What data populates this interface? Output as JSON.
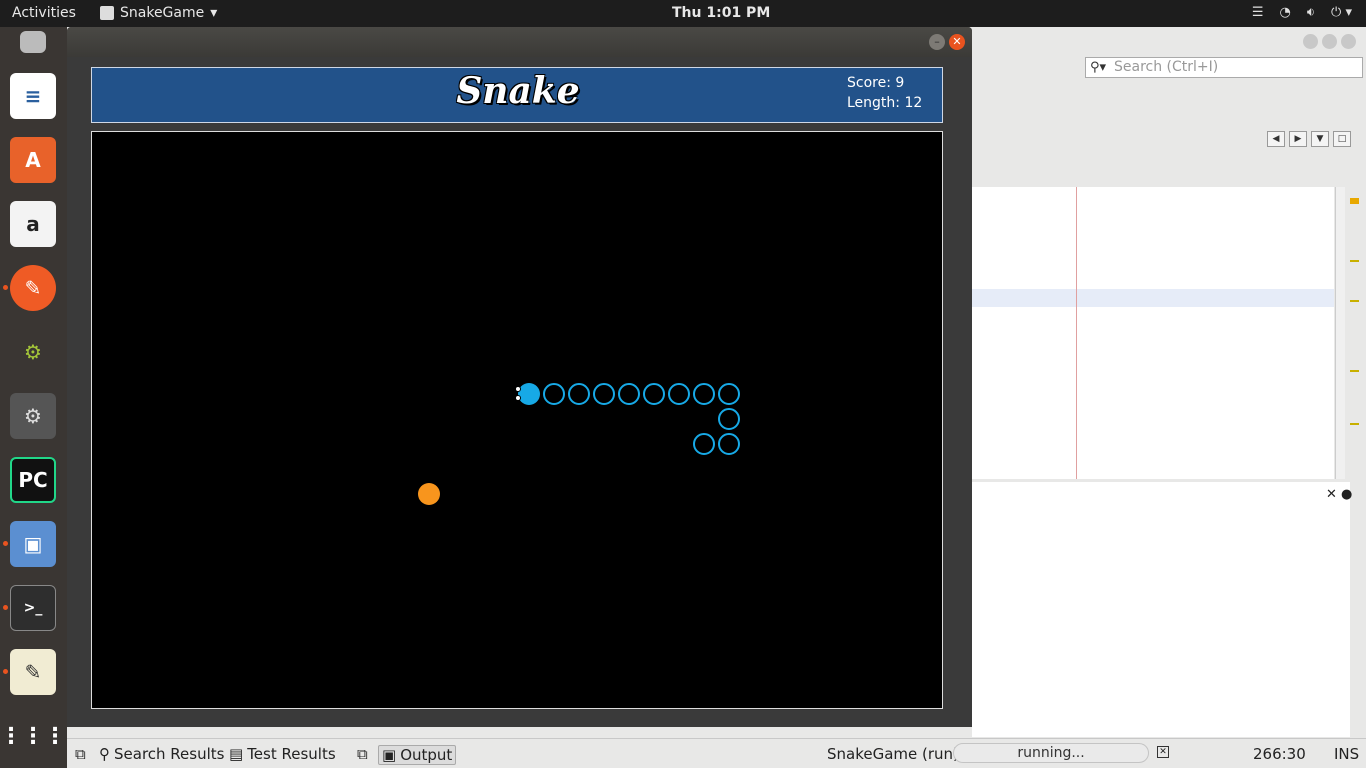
{
  "topbar": {
    "activities": "Activities",
    "app_name": "SnakeGame",
    "clock": "Thu  1:01 PM",
    "tray_icons": [
      "menu-icon",
      "wifi-icon",
      "volume-icon",
      "power-icon"
    ]
  },
  "dock": {
    "apps": [
      "files-icon",
      "writer-icon",
      "software-icon",
      "amazon-icon",
      "postman-icon",
      "android-studio-icon",
      "settings-icon",
      "pycharm-icon",
      "virtualbox-icon",
      "terminal-icon",
      "text-editor-icon",
      "show-apps-icon"
    ]
  },
  "ide": {
    "search_placeholder": "Search (Ctrl+I)"
  },
  "statusbar": {
    "search_results": "Search Results",
    "test_results": "Test Results",
    "output": "Output",
    "run_label": "SnakeGame (run)",
    "progress_text": "running...",
    "position": "266:30",
    "mode": "INS"
  },
  "game": {
    "title": "Snake",
    "score_label": "Score: 9",
    "length_label": "Length: 12",
    "snake_color": "#17a9e6",
    "food_color": "#f8951d",
    "direction": "left"
  }
}
